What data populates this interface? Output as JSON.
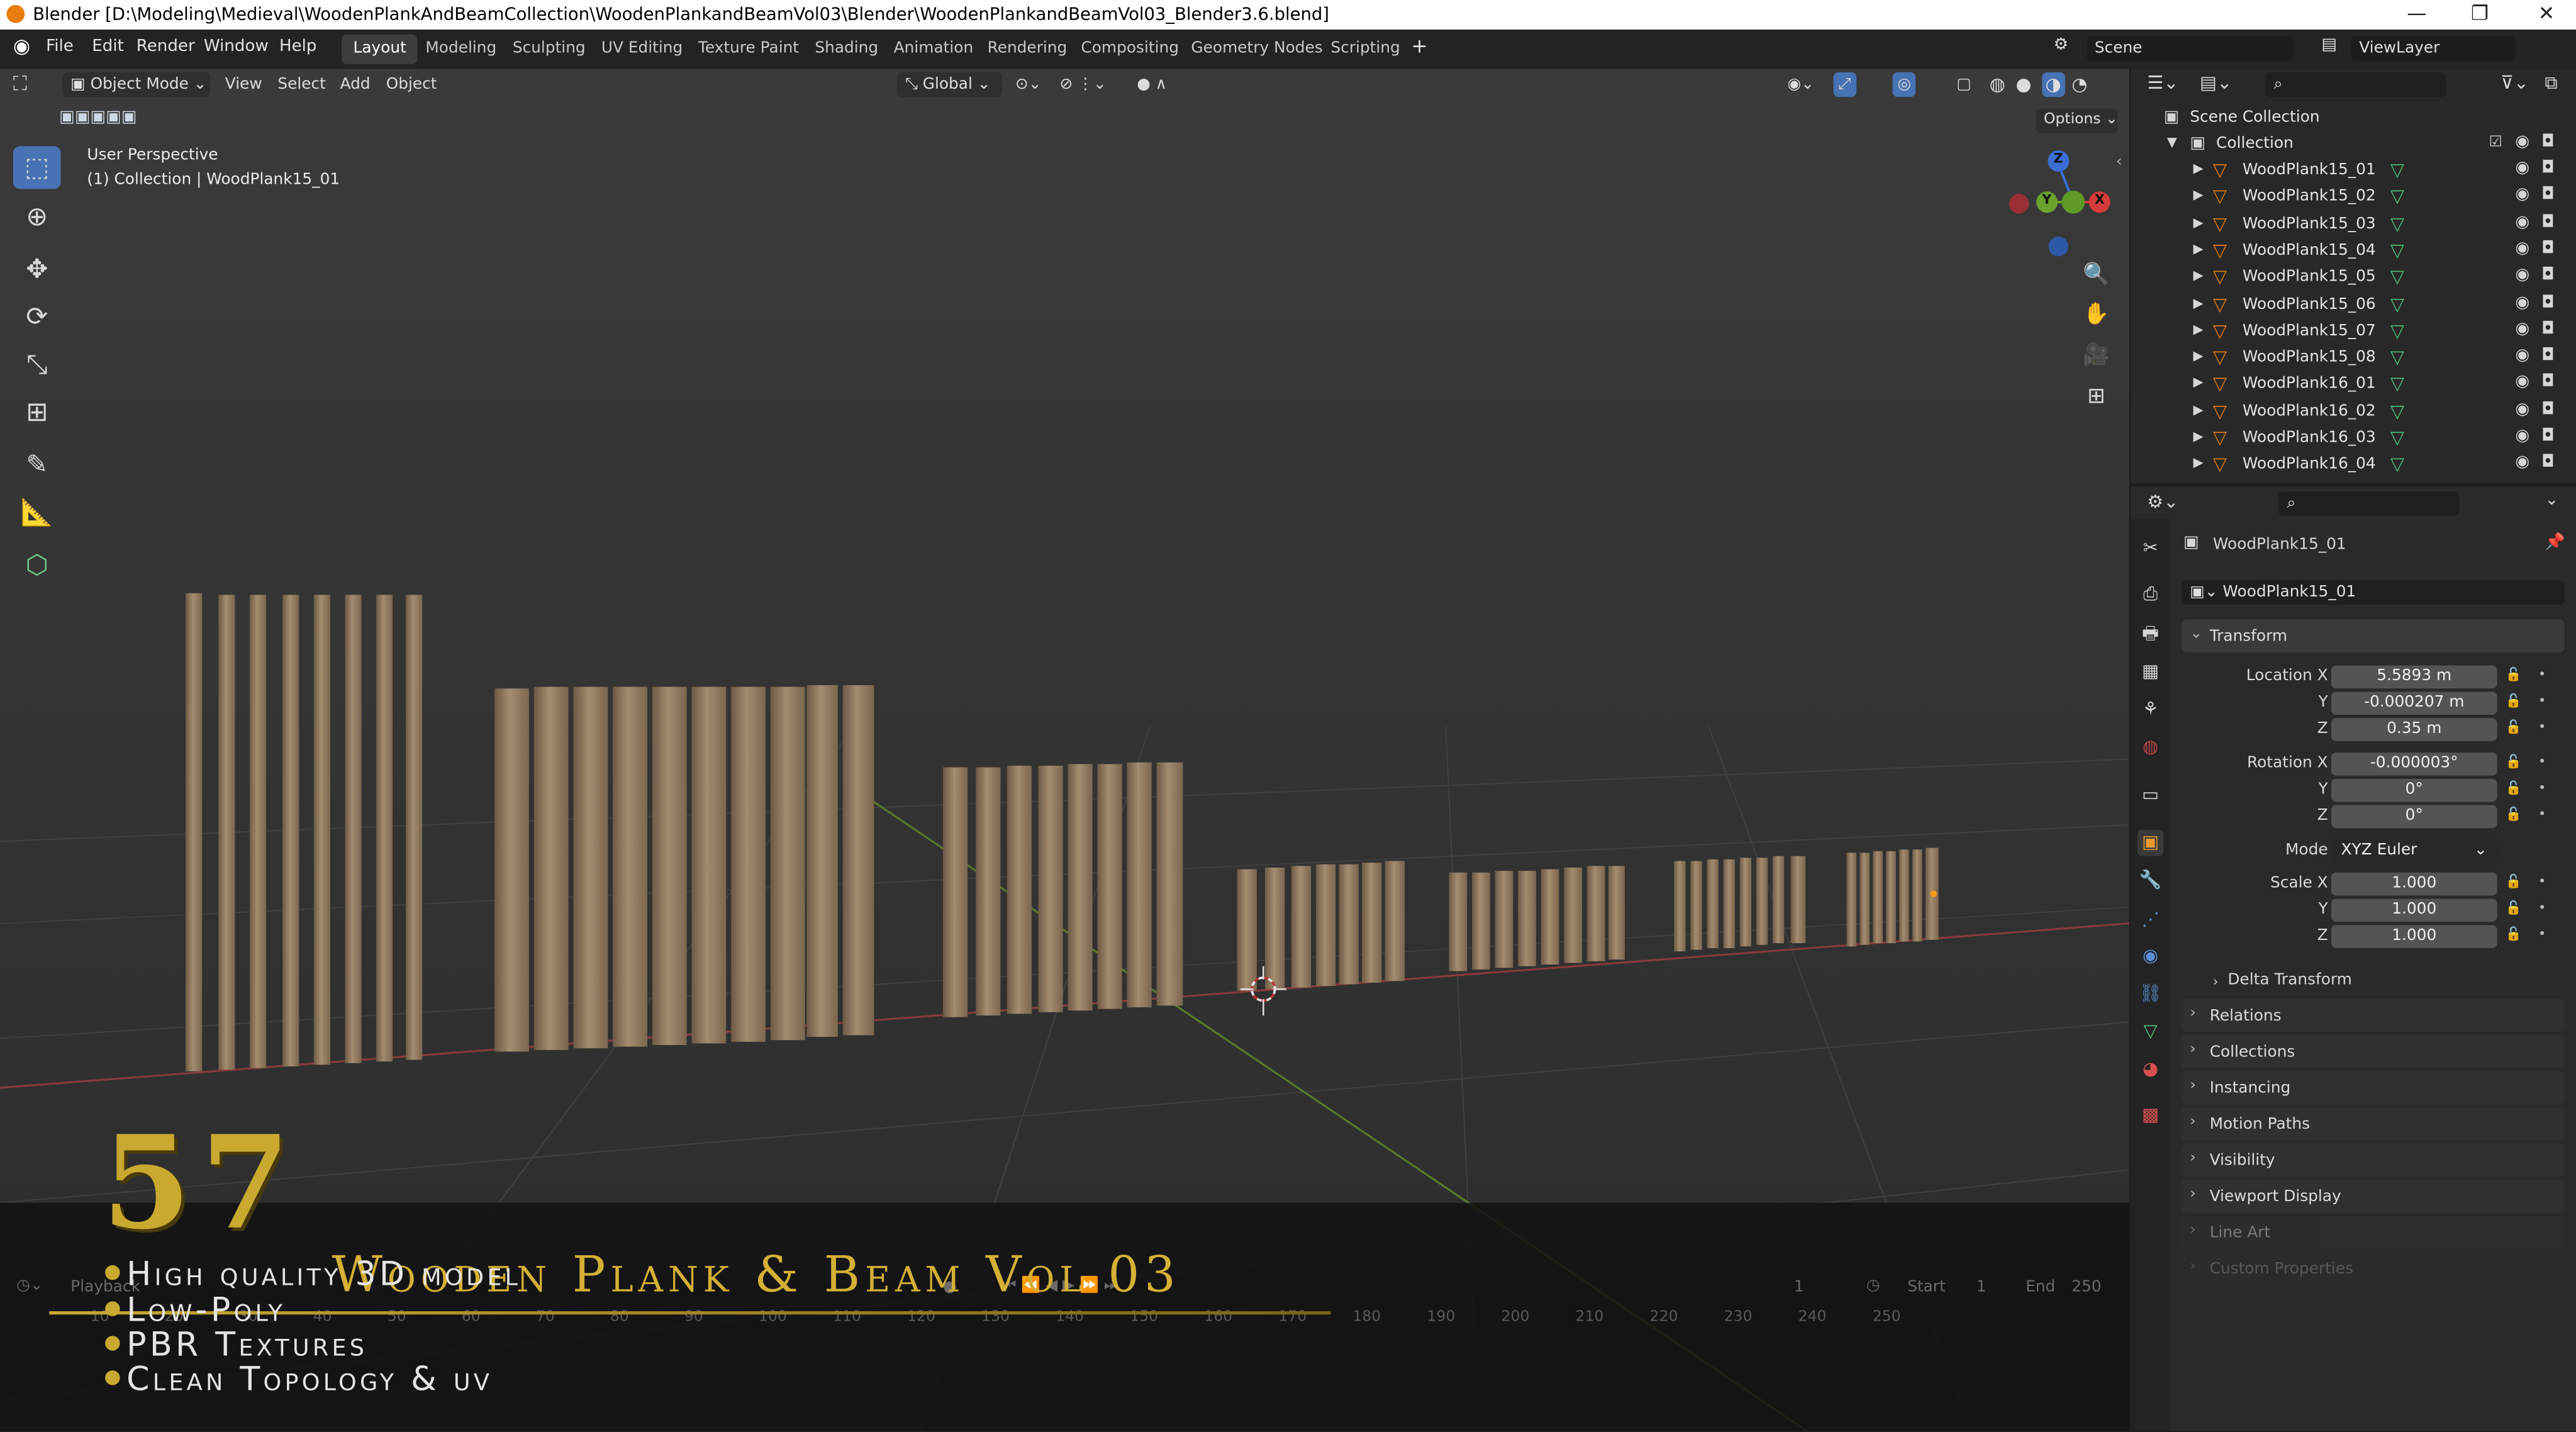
{
  "window": {
    "title": "Blender [D:\\Modeling\\Medieval\\WoodenPlankAndBeamCollection\\WoodenPlankandBeamVol03\\Blender\\WoodenPlankandBeamVol03_Blender3.6.blend]",
    "controls": [
      "—",
      "❐",
      "✕"
    ]
  },
  "menu": [
    "File",
    "Edit",
    "Render",
    "Window",
    "Help"
  ],
  "workspaces": [
    "Layout",
    "Modeling",
    "Sculpting",
    "UV Editing",
    "Texture Paint",
    "Shading",
    "Animation",
    "Rendering",
    "Compositing",
    "Geometry Nodes",
    "Scripting"
  ],
  "active_workspace": "Layout",
  "scene": {
    "name": "Scene",
    "view_layer": "ViewLayer"
  },
  "viewport": {
    "mode": "Object Mode",
    "menus": [
      "View",
      "Select",
      "Add",
      "Object"
    ],
    "orientation": "Global",
    "options_label": "Options",
    "overlay_line1": "User Perspective",
    "overlay_line2": "(1) Collection | WoodPlank15_01",
    "gizmo_axes": [
      "Z",
      "Y",
      "X"
    ]
  },
  "toolbar": [
    "select-box",
    "cursor",
    "move",
    "rotate",
    "scale",
    "transform",
    "annotate",
    "measure",
    "add-cube"
  ],
  "outliner": {
    "root": "Scene Collection",
    "collection": "Collection",
    "items": [
      "WoodPlank15_01",
      "WoodPlank15_02",
      "WoodPlank15_03",
      "WoodPlank15_04",
      "WoodPlank15_05",
      "WoodPlank15_06",
      "WoodPlank15_07",
      "WoodPlank15_08",
      "WoodPlank16_01",
      "WoodPlank16_02",
      "WoodPlank16_03",
      "WoodPlank16_04"
    ]
  },
  "properties": {
    "object_name": "WoodPlank15_01",
    "datablock": "WoodPlank15_01",
    "transform_label": "Transform",
    "location": {
      "label": "Location X",
      "x": "5.5893 m",
      "y": "-0.000207 m",
      "z": "0.35 m"
    },
    "rotation": {
      "label": "Rotation X",
      "x": "-0.000003°",
      "y": "0°",
      "z": "0°"
    },
    "mode_label": "Mode",
    "mode_value": "XYZ Euler",
    "scale": {
      "label": "Scale X",
      "x": "1.000",
      "y": "1.000",
      "z": "1.000"
    },
    "axis_y": "Y",
    "axis_z": "Z",
    "delta": "Delta Transform",
    "sections": [
      "Relations",
      "Collections",
      "Instancing",
      "Motion Paths",
      "Visibility",
      "Viewport Display",
      "Line Art",
      "Custom Properties"
    ]
  },
  "timeline": {
    "playback": "Playback",
    "frame": "1",
    "start_label": "Start",
    "start": "1",
    "end_label": "End",
    "end": "250",
    "ticks": [
      "10",
      "20",
      "30",
      "40",
      "50",
      "60",
      "70",
      "80",
      "90",
      "100",
      "110",
      "120",
      "130",
      "140",
      "150",
      "160",
      "170",
      "180",
      "190",
      "200",
      "210",
      "220",
      "230",
      "240",
      "250"
    ]
  },
  "promo": {
    "number": "57",
    "title": "Wooden Plank & Beam Vol 03",
    "features": [
      "High quality 3D model",
      "Low-Poly",
      "PBR Textures",
      "Clean Topology & uv"
    ]
  },
  "colors": {
    "accent": "#4772b3",
    "gold": "#c9a930",
    "orange": "#e87d0d",
    "mesh_green": "#4fbf7a"
  }
}
